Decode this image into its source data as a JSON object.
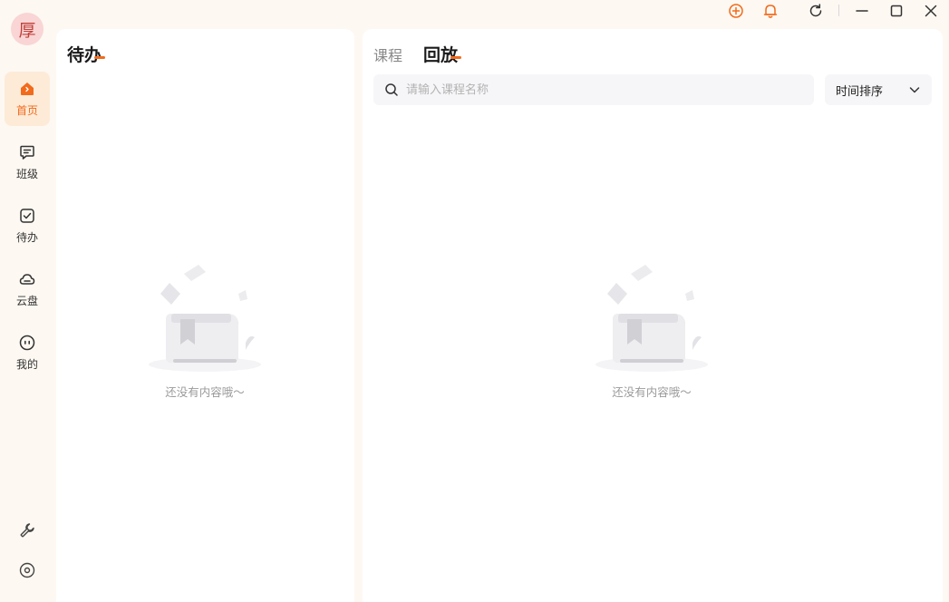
{
  "avatar": {
    "char": "厚"
  },
  "sidebar": {
    "items": [
      {
        "label": "首页",
        "icon": "home-icon",
        "active": true
      },
      {
        "label": "班级",
        "icon": "class-chat-icon",
        "active": false
      },
      {
        "label": "待办",
        "icon": "todo-check-icon",
        "active": false
      },
      {
        "label": "云盘",
        "icon": "cloud-drive-icon",
        "active": false
      },
      {
        "label": "我的",
        "icon": "profile-face-icon",
        "active": false
      }
    ],
    "tools": [
      {
        "icon": "wrench-icon"
      },
      {
        "icon": "settings-icon"
      }
    ]
  },
  "titlebar": {
    "icons": [
      "add-circle-icon",
      "bell-icon",
      "refresh-icon",
      "minimize-icon",
      "maximize-icon",
      "close-icon"
    ]
  },
  "todo_panel": {
    "title": "待办",
    "empty_text": "还没有内容哦～"
  },
  "main_panel": {
    "tabs": [
      {
        "label": "课程",
        "active": false
      },
      {
        "label": "回放",
        "active": true
      }
    ],
    "search": {
      "placeholder": "请输入课程名称",
      "value": ""
    },
    "sort": {
      "selected": "时间排序"
    },
    "empty_text": "还没有内容哦～"
  },
  "colors": {
    "accent": "#f26a1b",
    "background": "#fdf8f2",
    "panel": "#ffffff",
    "muted_text": "#9a9a9a"
  }
}
